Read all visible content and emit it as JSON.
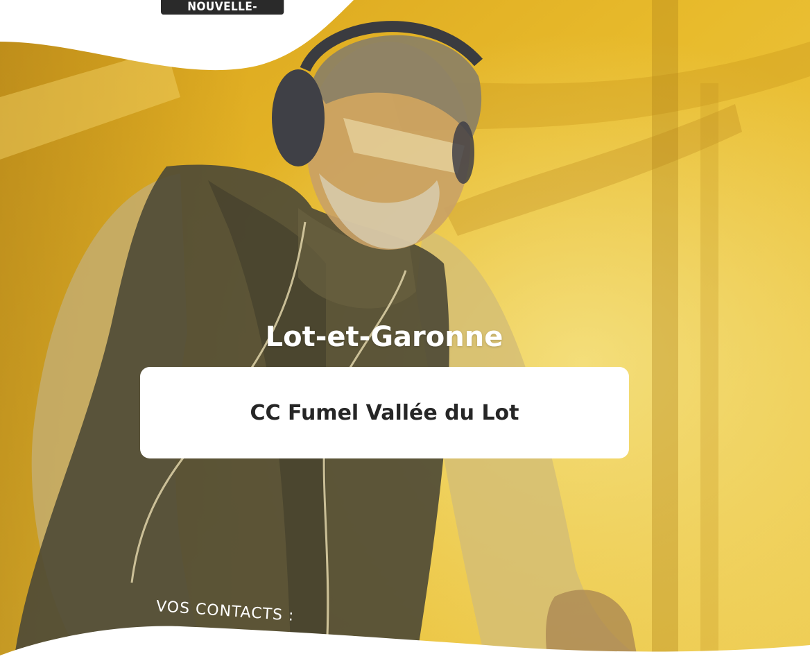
{
  "header": {
    "region_badge": "NOUVELLE-AQUITAINE"
  },
  "main": {
    "department": "Lot-et-Garonne",
    "community": "CC Fumel Vallée du Lot",
    "contacts_label": "VOS CONTACTS :"
  },
  "colors": {
    "photo_tint": "#e3b21e",
    "badge_bg": "#2a2a2a",
    "card_bg": "#ffffff",
    "text_dark": "#262626",
    "text_light": "#ffffff"
  },
  "icons": {
    "photo": "woodworker-photo"
  }
}
